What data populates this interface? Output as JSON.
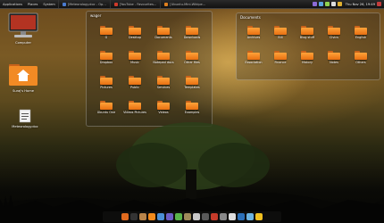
{
  "topbar": {
    "menus": [
      "Applications",
      "Places",
      "System"
    ],
    "tasks": [
      {
        "label": "[Meteorology.doc - Op...",
        "color": "#4a7bd0"
      },
      {
        "label": "[YouTube - Favourites...",
        "color": "#d03a2a"
      },
      {
        "label": "[Ubuntu-Mini-Wikipe...",
        "color": "#e0801e"
      }
    ],
    "clock": "Thu Nov 26, 19:49"
  },
  "desktop": {
    "icons": [
      {
        "label": "Computer",
        "kind": "computer-icon"
      },
      {
        "label": "Suraj's Home",
        "kind": "home-folder-icon"
      },
      {
        "label": "Meteorology.doc",
        "kind": "document-icon"
      }
    ]
  },
  "stack_left": {
    "title": "wager",
    "items": [
      "G",
      "Desktop",
      "Documents",
      "Downloads",
      "Dropbox",
      "Music",
      "Notepad docs",
      "Other files",
      "Pictures",
      "Public",
      "Services",
      "Templates",
      "Ubuntu One",
      "Videos Pictures",
      "Videos",
      "Examples"
    ]
  },
  "stack_right": {
    "title": "Documents",
    "items": [
      "Archives",
      "Bill",
      "Blog stuff",
      "Civics",
      "English",
      "Essociation",
      "Finance",
      "History",
      "Notes",
      "Others"
    ]
  },
  "dock": {
    "icons": [
      "firefox-icon",
      "terminal-icon",
      "files-icon",
      "vlc-icon",
      "music-icon",
      "mail-icon",
      "chat-icon",
      "gimp-icon",
      "editor-icon",
      "settings-icon",
      "photo-icon",
      "trash-icon",
      "clock-icon",
      "system-icon",
      "network-icon",
      "weather-icon"
    ]
  },
  "colors": {
    "folder": "#f4902a",
    "accent": "#e86f12"
  }
}
